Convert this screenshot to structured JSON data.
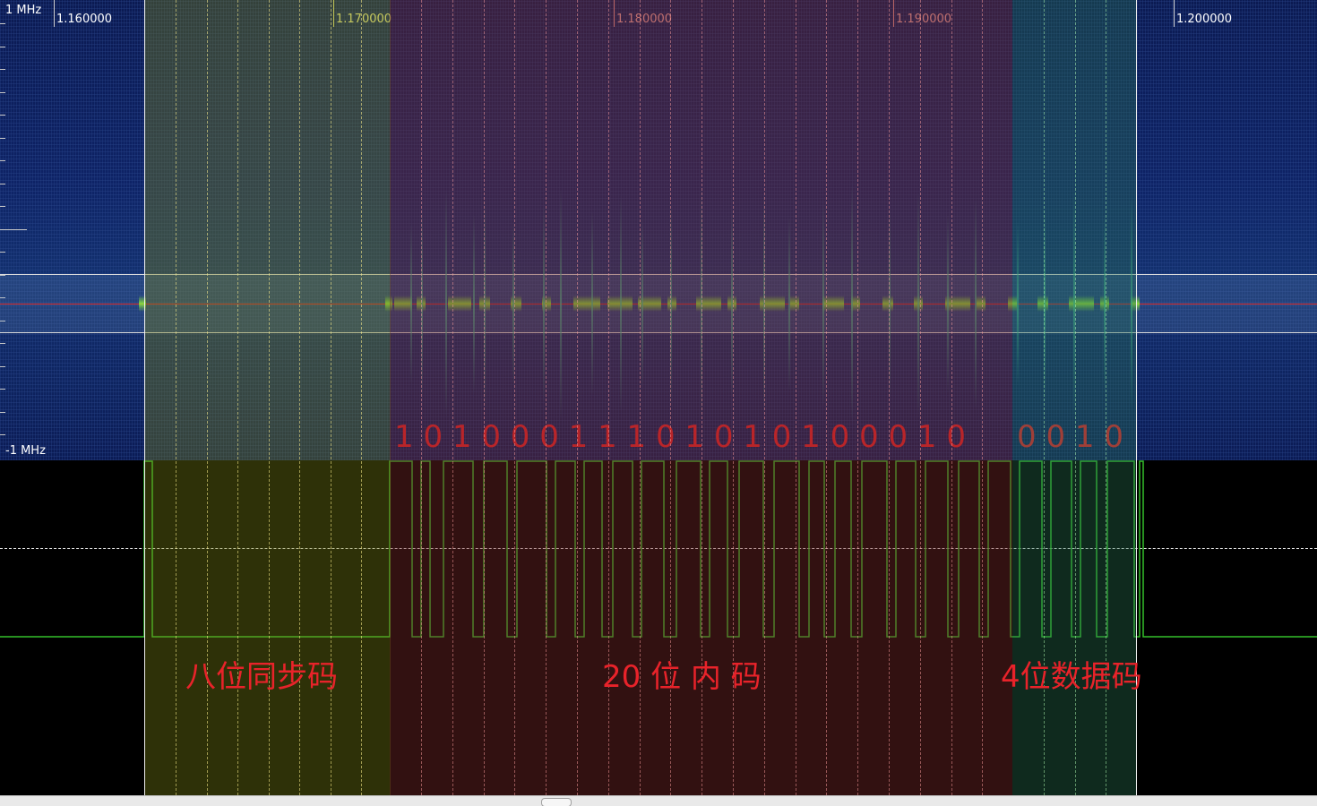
{
  "axis": {
    "ticks": [
      "1.160000",
      "1.170000",
      "1.180000",
      "1.190000",
      "1.200000"
    ],
    "top_freq": "1 MHz",
    "bottom_freq": "-1 MHz"
  },
  "bits": {
    "inner_code": "1 0 1  0  0 0 1  1 1  0 1  0 1  0 1 0  0 0 1  0",
    "data_code": "0 0 1  0"
  },
  "labels": {
    "sync": "八位同步码",
    "inner": "20  位  内 码",
    "data": "4位数据码"
  },
  "colors": {
    "sync_region": "#7a8214",
    "inner_region": "#782828",
    "data_region": "#286e50",
    "annotation": "#e8232a",
    "waveform": "#34c02a",
    "center_line": "#e03030"
  }
}
